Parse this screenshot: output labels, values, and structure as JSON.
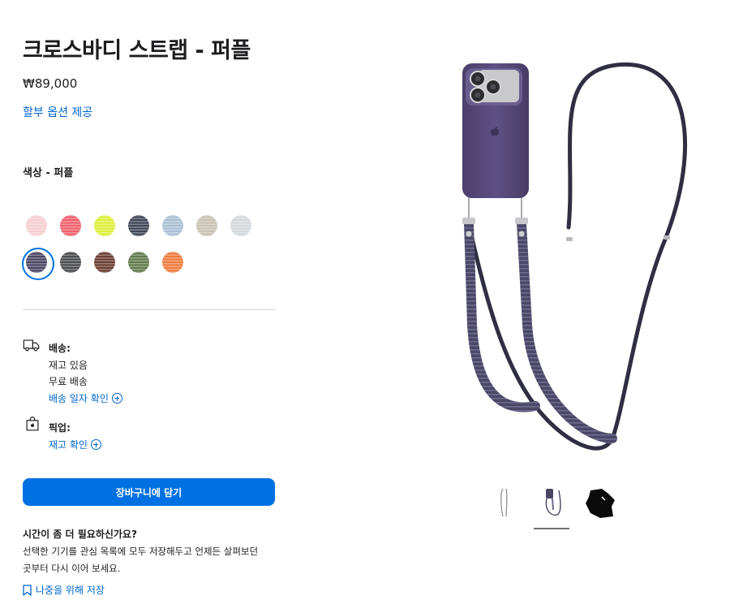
{
  "product": {
    "title": "크로스바디 스트랩 - 퍼플",
    "price": "₩89,000",
    "finance_link": "할부 옵션 제공",
    "color_label": "색상 - 퍼플"
  },
  "swatches": [
    {
      "name": "light-pink",
      "color": "#f5cdd0"
    },
    {
      "name": "coral",
      "color": "#ef5f6b"
    },
    {
      "name": "lime",
      "color": "#dcef3a"
    },
    {
      "name": "navy",
      "color": "#3f4557"
    },
    {
      "name": "light-blue",
      "color": "#a9c0d6"
    },
    {
      "name": "beige",
      "color": "#c8c2b2"
    },
    {
      "name": "light-gray",
      "color": "#d4d8dc"
    },
    {
      "name": "purple",
      "color": "#4a4565",
      "selected": true
    },
    {
      "name": "dark-gray",
      "color": "#4a4b4d"
    },
    {
      "name": "brown",
      "color": "#6a3d30"
    },
    {
      "name": "green",
      "color": "#5f7a4a"
    },
    {
      "name": "orange",
      "color": "#ee7a3c"
    }
  ],
  "delivery": {
    "title": "배송:",
    "line1": "재고 있음",
    "line2": "무료 배송",
    "link": "배송 일자 확인"
  },
  "pickup": {
    "title": "픽업:",
    "link": "재고 확인"
  },
  "cart_button": "장바구니에 담기",
  "more_time": {
    "title": "시간이 좀 더 필요하신가요?",
    "line1": "선택한 기기를 관심 목록에 모두 저장해두고 언제든 살펴보던",
    "line2": "곳부터 다시 이어 보세요.",
    "save_link": "나중을 위해 저장"
  },
  "icons": {
    "truck": "truck-icon",
    "bag": "shopping-bag-icon",
    "bookmark": "bookmark-icon",
    "plus": "plus-circle-icon"
  },
  "colors": {
    "accent": "#0071e3",
    "link": "#0066cc",
    "strap": "#3b3a54",
    "case": "#5a4c7a"
  }
}
